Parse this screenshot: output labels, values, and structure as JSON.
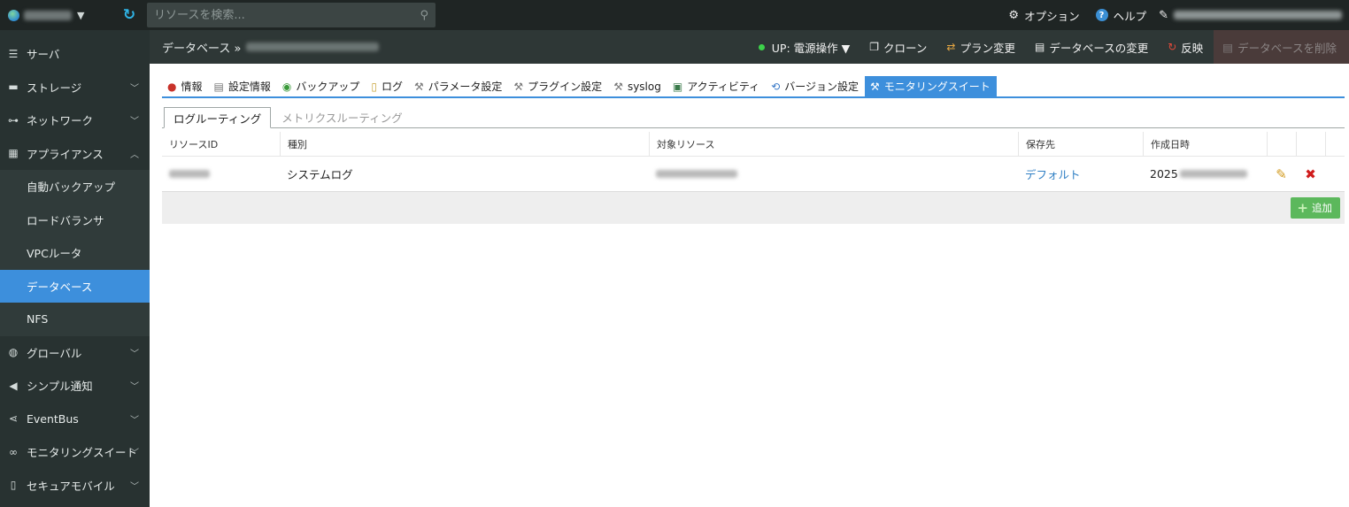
{
  "topbar": {
    "search_placeholder": "リソースを検索...",
    "options_label": "オプション",
    "help_label": "ヘルプ"
  },
  "breadcrumb": {
    "root": "データベース »"
  },
  "actions": {
    "power_label": "UP: 電源操作 ▼",
    "clone_label": "クローン",
    "plan_label": "プラン変更",
    "change_label": "データベースの変更",
    "reflect_label": "反映",
    "delete_label": "データベースを削除"
  },
  "sidebar": {
    "items": [
      {
        "label": "サーバ"
      },
      {
        "label": "ストレージ"
      },
      {
        "label": "ネットワーク"
      },
      {
        "label": "アプライアンス"
      },
      {
        "label": "自動バックアップ"
      },
      {
        "label": "ロードバランサ"
      },
      {
        "label": "VPCルータ"
      },
      {
        "label": "データベース"
      },
      {
        "label": "NFS"
      },
      {
        "label": "グローバル"
      },
      {
        "label": "シンプル通知"
      },
      {
        "label": "EventBus"
      },
      {
        "label": "モニタリングスイート"
      },
      {
        "label": "セキュアモバイル"
      }
    ]
  },
  "tabs": [
    {
      "label": "情報"
    },
    {
      "label": "設定情報"
    },
    {
      "label": "バックアップ"
    },
    {
      "label": "ログ"
    },
    {
      "label": "パラメータ設定"
    },
    {
      "label": "プラグイン設定"
    },
    {
      "label": "syslog"
    },
    {
      "label": "アクティビティ"
    },
    {
      "label": "バージョン設定"
    },
    {
      "label": "モニタリングスイート"
    }
  ],
  "subtabs": [
    {
      "label": "ログルーティング"
    },
    {
      "label": "メトリクスルーティング"
    }
  ],
  "table": {
    "headers": [
      "リソースID",
      "種別",
      "対象リソース",
      "保存先",
      "作成日時"
    ],
    "rows": [
      {
        "type": "システムログ",
        "destination": "デフォルト",
        "created": "2025"
      }
    ]
  },
  "add_button_label": "追加",
  "colors": {
    "accent": "#3d8fdc",
    "topbar": "#1f2524",
    "sidebar": "#283231",
    "add_green": "#5cb85c",
    "status_up": "#3cd24a"
  }
}
